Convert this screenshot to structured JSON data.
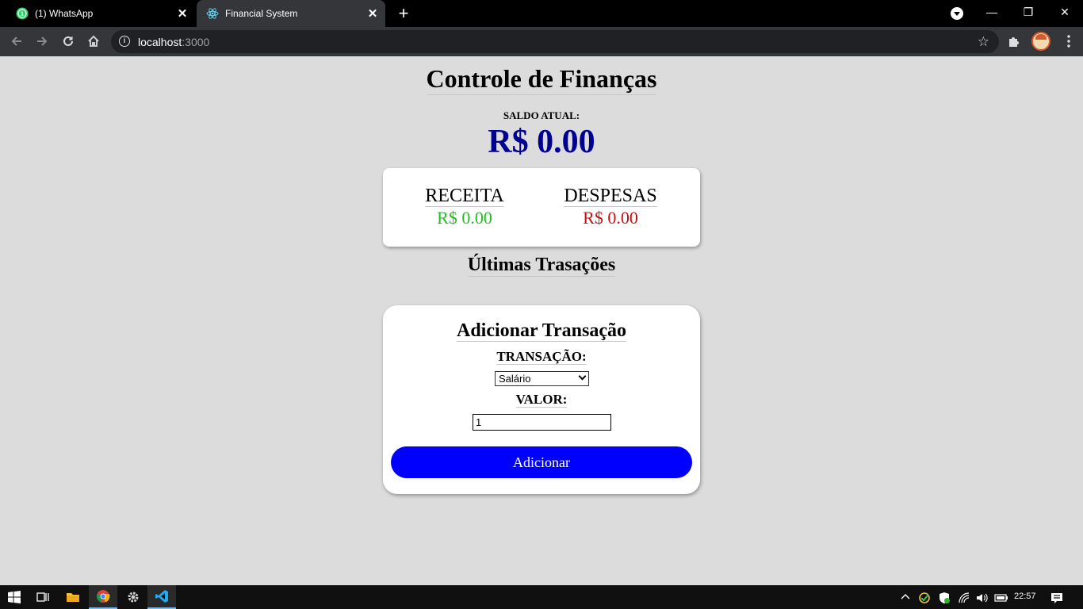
{
  "browser": {
    "tabs": [
      {
        "title": "(1) WhatsApp",
        "active": false,
        "icon": "whatsapp-icon"
      },
      {
        "title": "Financial System",
        "active": true,
        "icon": "react-icon"
      }
    ],
    "url_host": "localhost",
    "url_port": ":3000"
  },
  "page": {
    "title": "Controle de Finanças",
    "balance_label": "SALDO ATUAL:",
    "balance_value": "R$ 0.00",
    "summary": {
      "income_label": "RECEITA",
      "income_value": "R$ 0.00",
      "expense_label": "DESPESAS",
      "expense_value": "R$ 0.00"
    },
    "transactions_title": "Últimas Trasações",
    "form": {
      "title": "Adicionar Transação",
      "transaction_label": "TRANSAÇÃO:",
      "transaction_selected": "Salário",
      "value_label": "VALOR:",
      "value_input": "1",
      "submit_label": "Adicionar"
    }
  },
  "taskbar": {
    "clock": "22:57"
  },
  "colors": {
    "balance": "#000090",
    "income": "#1fbf1f",
    "expense": "#c81010",
    "button": "#0000ff",
    "background": "#dcdcdc"
  }
}
